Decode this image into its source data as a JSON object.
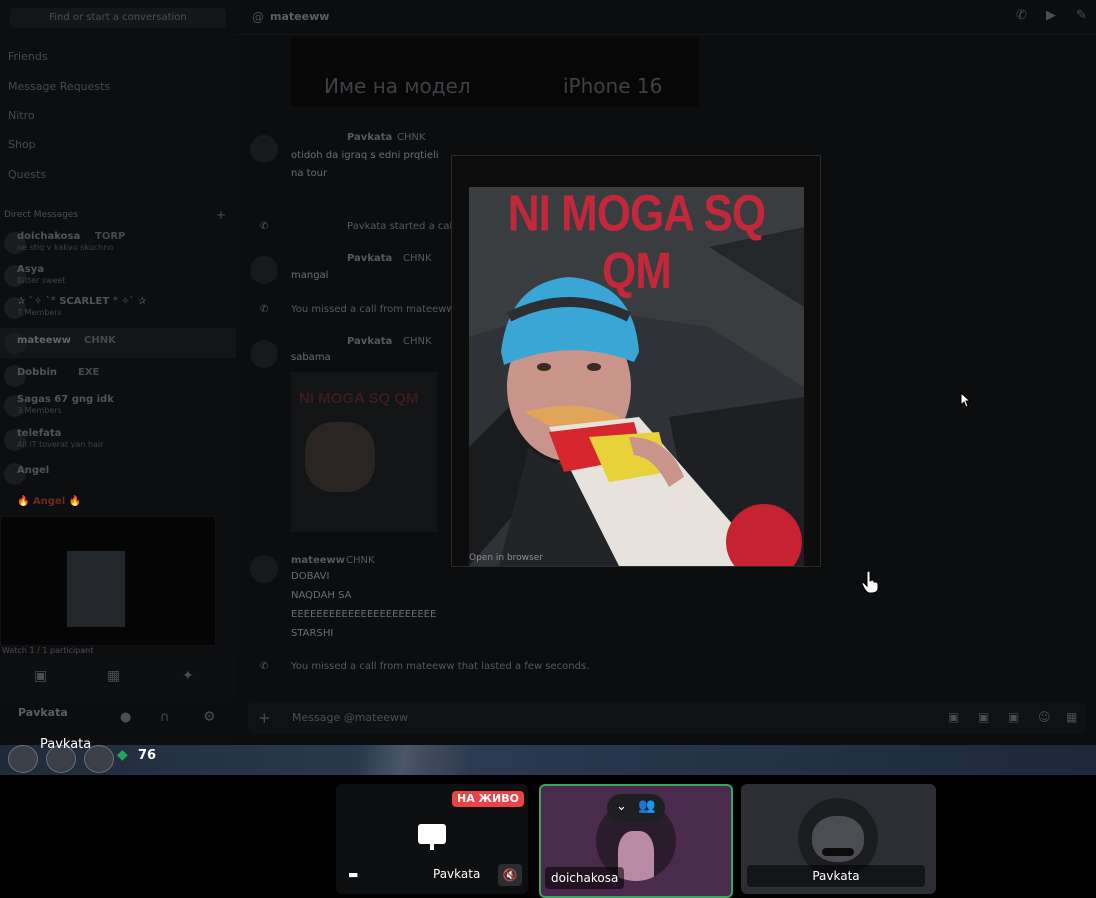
{
  "sidebar": {
    "search_placeholder": "Find or start a conversation",
    "nav": [
      "Friends",
      "Message Requests",
      "Nitro",
      "Shop",
      "Quests"
    ],
    "dm_header": "Direct Messages",
    "dms": [
      {
        "name": "doichakosa",
        "tag": "TORP",
        "status": "ne stiq v kakvo skuchno"
      },
      {
        "name": "Asya",
        "tag": "",
        "status": "Bitter sweet"
      },
      {
        "name": "✰ `✧ `° SCARLET ° ✧` ✰",
        "tag": "",
        "status": "7 Members"
      },
      {
        "name": "mateeww",
        "tag": "CHNK",
        "status": ""
      },
      {
        "name": "Dobbin",
        "tag": "EXE",
        "status": ""
      },
      {
        "name": "Sagas 67 gng idk",
        "tag": "",
        "status": "3 Members"
      },
      {
        "name": "telefata",
        "tag": "",
        "status": "Ail iT toverat yan hair"
      },
      {
        "name": "Angel",
        "tag": "",
        "status": ""
      },
      {
        "name": "🔥 Angel 🔥",
        "tag": "",
        "status": ""
      }
    ],
    "screenshare_label": "Watch 1 / 1 participant",
    "user": "Pavkata"
  },
  "chat": {
    "channel": "mateeww",
    "pinned_header_left": "Име на модел",
    "pinned_header_right": "iPhone 16",
    "messages": [
      {
        "author": "Pavkata",
        "tag": "CHNK",
        "text": "otidoh da igraq s edni prqtieli"
      },
      {
        "author": "",
        "tag": "",
        "text": "na tour"
      },
      {
        "author": "Pavkata",
        "tag": "",
        "text": "Pavkata started a call"
      },
      {
        "author": "Pavkata",
        "tag": "CHNK",
        "text": "mangal"
      },
      {
        "author": "",
        "tag": "",
        "text": "You missed a call from mateeww"
      },
      {
        "author": "Pavkata",
        "tag": "CHNK",
        "text": "sabama"
      },
      {
        "author": "mateeww",
        "tag": "CHNK",
        "text": "DOBAVI"
      },
      {
        "author": "",
        "tag": "",
        "text": "NAQDAH SA"
      },
      {
        "author": "",
        "tag": "",
        "text": "EEEEEEEEEEEEEEEEEEEEEEE"
      },
      {
        "author": "",
        "tag": "",
        "text": "STARSHI"
      },
      {
        "author": "",
        "tag": "",
        "text": "You missed a call from mateeww that lasted a few seconds."
      }
    ],
    "input_placeholder": "Message @mateeww"
  },
  "viewer": {
    "caption": "NI MOGA SQ QM",
    "thumb_caption": "NI MOGA SQ QM",
    "footer_link": "Open in browser"
  },
  "stream": {
    "streamer": "Pavkata",
    "gem_count": "76"
  },
  "tiles": [
    {
      "name": "Pavkata",
      "badge": "НА ЖИВО"
    },
    {
      "name": "doichakosa"
    },
    {
      "name": "Pavkata"
    }
  ],
  "colors": {
    "live_badge": "#ed4245",
    "speaking_border": "#3ba55c",
    "caption_red": "#c3273a",
    "gem_green": "#23a559"
  }
}
